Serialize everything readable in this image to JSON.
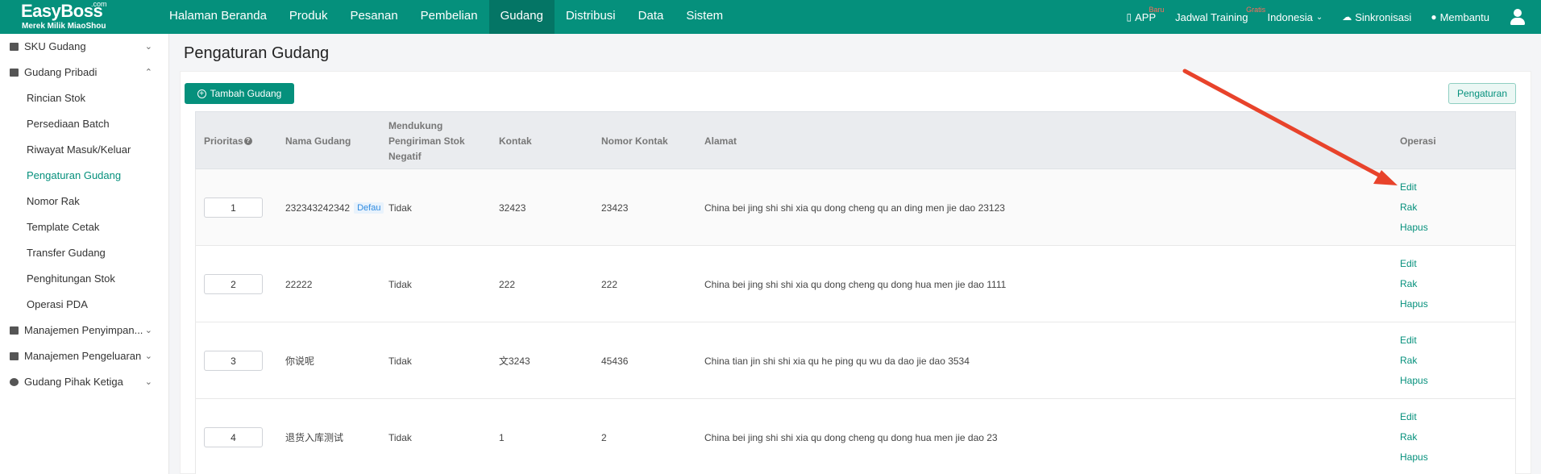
{
  "app": {
    "name": "EasyBoss",
    "com": ".com",
    "subtitle": "Merek Milik MiaoShou"
  },
  "nav": {
    "items": [
      {
        "label": "Halaman Beranda"
      },
      {
        "label": "Produk"
      },
      {
        "label": "Pesanan"
      },
      {
        "label": "Pembelian"
      },
      {
        "label": "Gudang",
        "active": true
      },
      {
        "label": "Distribusi"
      },
      {
        "label": "Data"
      },
      {
        "label": "Sistem"
      }
    ]
  },
  "tools": {
    "app_label": "APP",
    "app_badge": "Baru",
    "training_label": "Jadwal Training",
    "training_badge": "Gratis",
    "language": "Indonesia",
    "sync": "Sinkronisasi",
    "help": "Membantu"
  },
  "sidebar": {
    "groups": [
      {
        "label": "SKU Gudang",
        "expanded": false
      },
      {
        "label": "Gudang Pribadi",
        "expanded": true
      }
    ],
    "items": [
      {
        "label": "Rincian Stok"
      },
      {
        "label": "Persediaan Batch"
      },
      {
        "label": "Riwayat Masuk/Keluar"
      },
      {
        "label": "Pengaturan Gudang",
        "active": true
      },
      {
        "label": "Nomor Rak"
      },
      {
        "label": "Template Cetak"
      },
      {
        "label": "Transfer Gudang"
      },
      {
        "label": "Penghitungan Stok"
      },
      {
        "label": "Operasi PDA"
      }
    ],
    "bottom_groups": [
      {
        "label": "Manajemen Penyimpan..."
      },
      {
        "label": "Manajemen Pengeluaran"
      },
      {
        "label": "Gudang Pihak Ketiga"
      }
    ]
  },
  "page": {
    "title": "Pengaturan Gudang",
    "add_button": "Tambah Gudang",
    "settings_button": "Pengaturan"
  },
  "table": {
    "headers": {
      "priority": "Prioritas",
      "name": "Nama Gudang",
      "negative": "Mendukung Pengiriman Stok Negatif",
      "contact": "Kontak",
      "phone": "Nomor Kontak",
      "address": "Alamat",
      "ops": "Operasi"
    },
    "op_labels": {
      "edit": "Edit",
      "rack": "Rak",
      "delete": "Hapus"
    },
    "rows": [
      {
        "priority": "1",
        "name": "232343242342",
        "badge": "Defau",
        "negative": "Tidak",
        "contact": "32423",
        "phone": "23423",
        "address": "China bei jing shi shi xia qu dong cheng qu an ding men jie dao 23123"
      },
      {
        "priority": "2",
        "name": "22222",
        "negative": "Tidak",
        "contact": "222",
        "phone": "222",
        "address": "China bei jing shi shi xia qu dong cheng qu dong hua men jie dao 1111"
      },
      {
        "priority": "3",
        "name": "你说呢",
        "negative": "Tidak",
        "contact": "文3243",
        "phone": "45436",
        "address": "China tian jin shi shi xia qu he ping qu wu da dao jie dao 3534"
      },
      {
        "priority": "4",
        "name": "退货入库测试",
        "negative": "Tidak",
        "contact": "1",
        "phone": "2",
        "address": "China bei jing shi shi xia qu dong cheng qu dong hua men jie dao 23"
      }
    ]
  },
  "colors": {
    "brand": "#05907c",
    "annotation_arrow": "#e8432b"
  }
}
